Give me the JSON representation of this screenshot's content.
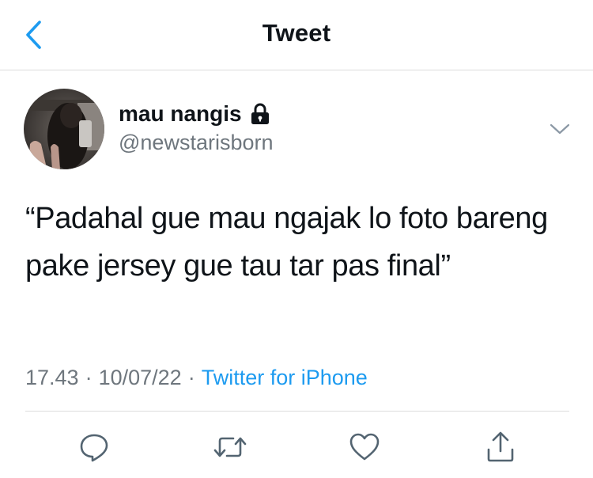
{
  "header": {
    "title": "Tweet",
    "back_icon": "chevron-left-icon"
  },
  "tweet": {
    "display_name": "mau nangis",
    "protected_icon": "lock-icon",
    "handle": "@newstarisborn",
    "text": "“Padahal gue mau ngajak lo foto bareng pake jersey gue tau tar pas final”",
    "time": "17.43",
    "date": "10/07/22",
    "separator": "·",
    "source": "Twitter for iPhone"
  },
  "actions": [
    {
      "name": "reply",
      "icon": "reply-icon"
    },
    {
      "name": "retweet",
      "icon": "retweet-icon"
    },
    {
      "name": "like",
      "icon": "heart-icon"
    },
    {
      "name": "share",
      "icon": "share-icon"
    }
  ],
  "colors": {
    "accent": "#1d9bf0",
    "text": "#0f1419",
    "secondary": "#6e767d",
    "divider": "#dcdcdc",
    "background": "#ffffff"
  }
}
